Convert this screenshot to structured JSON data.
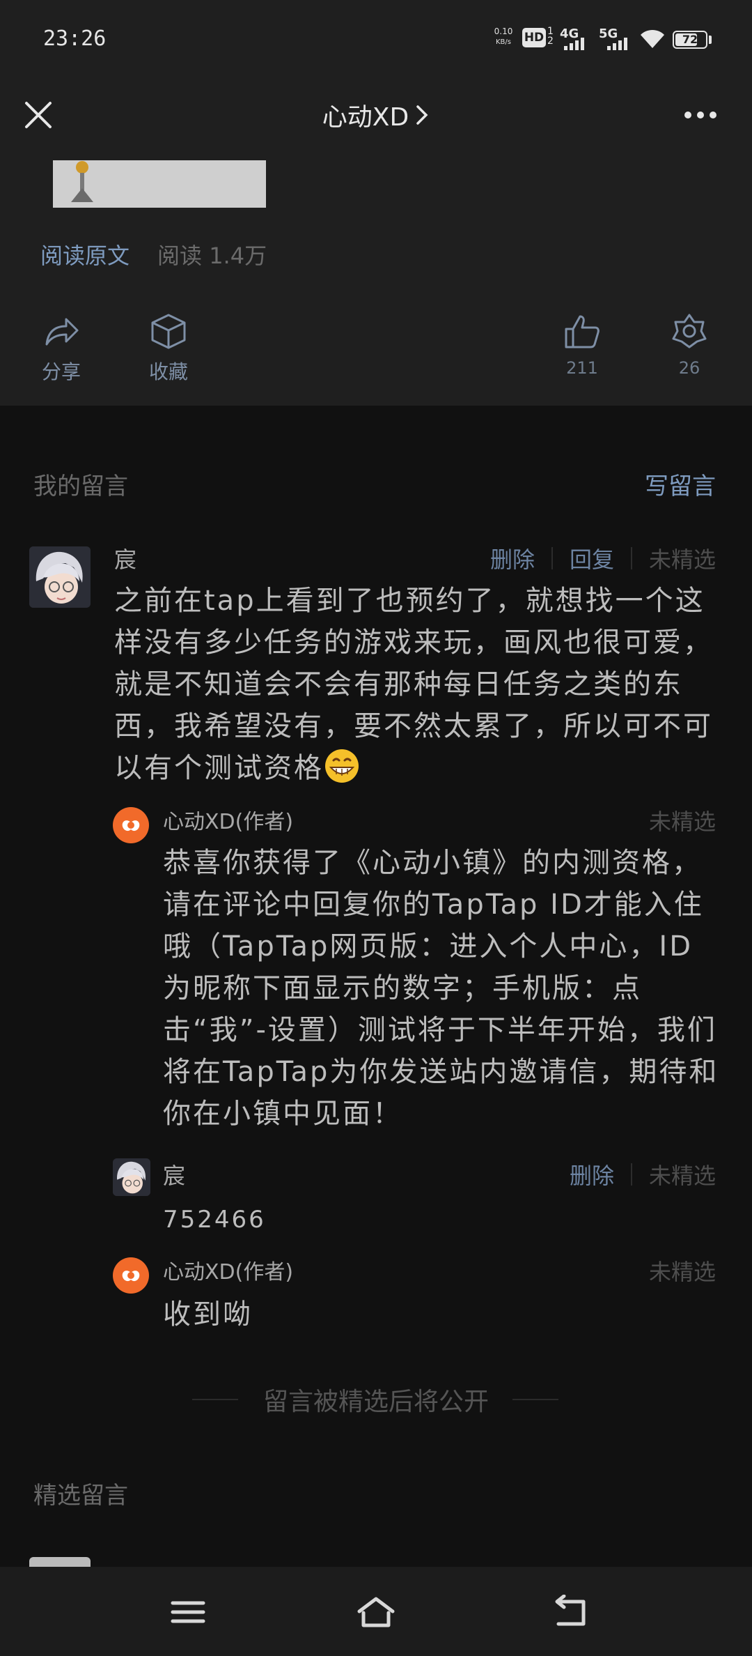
{
  "status_bar": {
    "time": "23:26",
    "net_speed_value": "0.10",
    "net_speed_unit": "KB/s",
    "hd_label": "HD",
    "hd_sub": "1",
    "hd_sub2": "2",
    "net1": "4G",
    "net2": "5G",
    "battery": "72"
  },
  "nav": {
    "title": "心动XD"
  },
  "article": {
    "read_original": "阅读原文",
    "read_count": "阅读 1.4万"
  },
  "actions": {
    "share": "分享",
    "collect": "收藏",
    "like_count": "211",
    "wow_count": "26"
  },
  "my_comments": {
    "title": "我的留言",
    "write": "写留言",
    "comment": {
      "nickname": "宸",
      "delete": "删除",
      "reply": "回复",
      "status": "未精选",
      "text": "之前在tap上看到了也预约了，就想找一个这样没有多少任务的游戏来玩，画风也很可爱，就是不知道会不会有那种每日任务之类的东西，我希望没有，要不然太累了，所以可不可以有个测试资格"
    },
    "replies": [
      {
        "nickname": "心动XD(作者)",
        "status": "未精选",
        "text": "恭喜你获得了《心动小镇》的内测资格，请在评论中回复你的TapTap ID才能入住哦（TapTap网页版：进入个人中心，ID为昵称下面显示的数字；手机版：点击“我”-设置）测试将于下半年开始，我们将在TapTap为你发送站内邀请信，期待和你在小镇中见面！"
      },
      {
        "nickname": "宸",
        "delete": "删除",
        "status": "未精选",
        "text": "752466"
      },
      {
        "nickname": "心动XD(作者)",
        "status": "未精选",
        "text": "收到呦"
      }
    ],
    "notice": "留言被精选后将公开"
  },
  "featured": {
    "title": "精选留言"
  },
  "colors": {
    "background": "#111111",
    "panel": "#1f1f1f",
    "link_blue": "#7e9bbf",
    "brand_orange": "#f16a2a"
  }
}
